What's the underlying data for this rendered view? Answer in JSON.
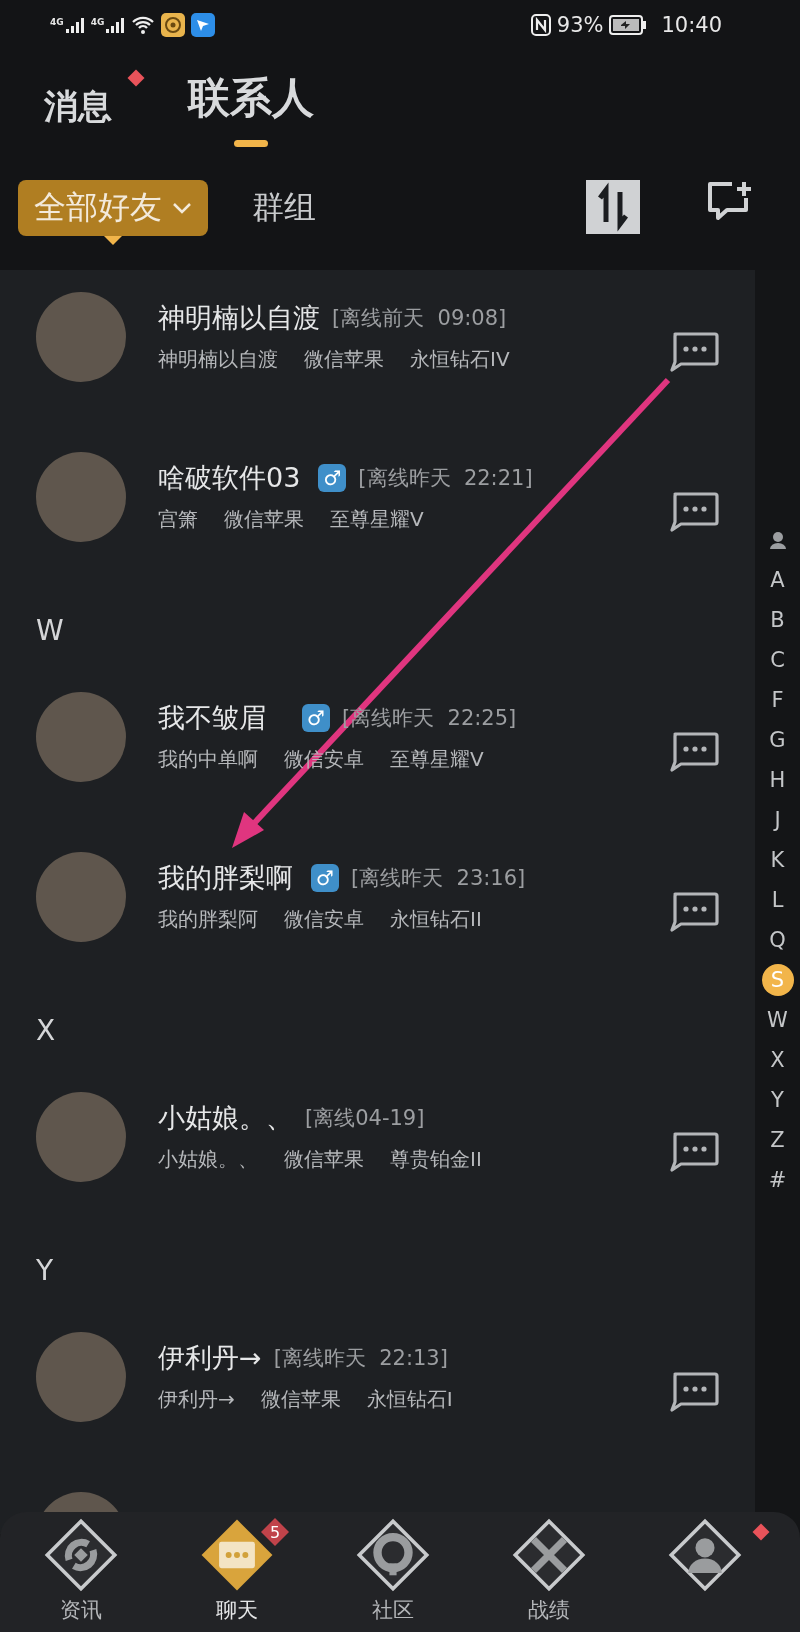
{
  "status_bar": {
    "signal_labels": [
      "4G",
      "4G"
    ],
    "battery": "93%",
    "time": "10:40"
  },
  "tabs": [
    {
      "label": "消息",
      "selected": false,
      "dot": true
    },
    {
      "label": "联系人",
      "selected": true,
      "dot": false
    }
  ],
  "filters": [
    {
      "label": "全部好友",
      "selected": true,
      "dropdown": true
    },
    {
      "label": "群组",
      "selected": false,
      "dropdown": false
    }
  ],
  "list": [
    {
      "kind": "contact",
      "name": "神明楠以自渡",
      "status": "[离线前天  09:08]",
      "nickname": "神明楠以自渡",
      "platform": "微信苹果",
      "rank": "永恒钻石IV"
    },
    {
      "kind": "contact",
      "name": "啥破软件03",
      "badge": "♂",
      "status": "[离线昨天  22:21]",
      "nickname": "宫箫",
      "platform": "微信苹果",
      "rank": "至尊星耀V"
    },
    {
      "kind": "header",
      "letter": "W"
    },
    {
      "kind": "contact",
      "name": "我不皱眉",
      "badge": "♂",
      "status": "[离线昨天  22:25]",
      "nickname": "我的中单啊",
      "platform": "微信安卓",
      "rank": "至尊星耀V"
    },
    {
      "kind": "contact",
      "name": "我的胖梨啊",
      "badge": "♂",
      "status": "[离线昨天  23:16]",
      "nickname": "我的胖梨阿",
      "platform": "微信安卓",
      "rank": "永恒钻石II"
    },
    {
      "kind": "header",
      "letter": "X"
    },
    {
      "kind": "contact",
      "name": "小姑娘。、",
      "status": "[离线04-19]",
      "nickname": "小姑娘。、",
      "platform": "微信苹果",
      "rank": "尊贵铂金II"
    },
    {
      "kind": "header",
      "letter": "Y"
    },
    {
      "kind": "contact",
      "name": "伊利丹→",
      "status": "[离线昨天  22:13]",
      "nickname": "伊利丹→",
      "platform": "微信苹果",
      "rank": "永恒钻石I"
    },
    {
      "kind": "cutoff"
    }
  ],
  "index": [
    {
      "kind": "person"
    },
    {
      "label": "A",
      "selected": false
    },
    {
      "label": "B",
      "selected": false
    },
    {
      "label": "C",
      "selected": false
    },
    {
      "label": "F",
      "selected": false
    },
    {
      "label": "G",
      "selected": false
    },
    {
      "label": "H",
      "selected": false
    },
    {
      "label": "J",
      "selected": false
    },
    {
      "label": "K",
      "selected": false
    },
    {
      "label": "L",
      "selected": false
    },
    {
      "label": "Q",
      "selected": false
    },
    {
      "label": "S",
      "selected": true
    },
    {
      "label": "W",
      "selected": false
    },
    {
      "label": "X",
      "selected": false
    },
    {
      "label": "Y",
      "selected": false
    },
    {
      "label": "Z",
      "selected": false
    },
    {
      "label": "#",
      "selected": false
    }
  ],
  "bottom_nav": [
    {
      "kind": "news",
      "label": "资讯",
      "selected": false
    },
    {
      "kind": "chat",
      "label": "聊天",
      "selected": true,
      "badge": "5"
    },
    {
      "kind": "community",
      "label": "社区",
      "selected": false
    },
    {
      "kind": "record",
      "label": "战绩",
      "selected": false
    },
    {
      "kind": "profile",
      "selected": false,
      "dot": true
    }
  ]
}
